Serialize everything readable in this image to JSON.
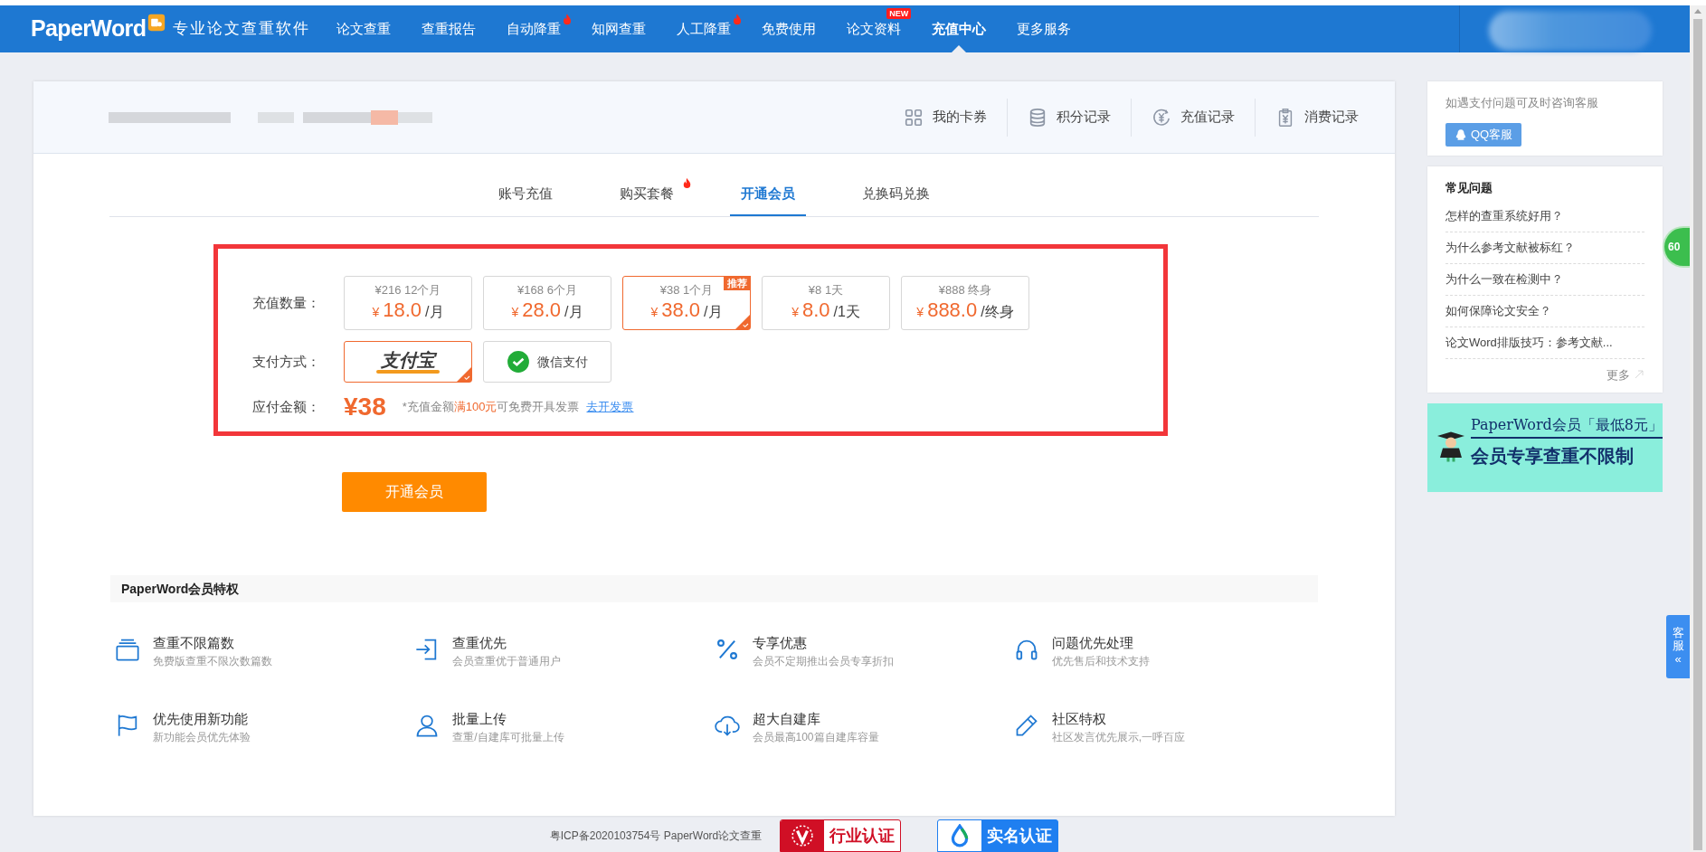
{
  "nav": {
    "logo": "PaperWord",
    "slogan": "专业论文查重软件",
    "items": [
      {
        "label": "论文查重",
        "hot": false,
        "selected": false
      },
      {
        "label": "查重报告",
        "hot": false,
        "selected": false
      },
      {
        "label": "自动降重",
        "hot": true,
        "selected": false
      },
      {
        "label": "知网查重",
        "hot": false,
        "selected": false
      },
      {
        "label": "人工降重",
        "hot": true,
        "selected": false
      },
      {
        "label": "免费使用",
        "hot": false,
        "selected": false
      },
      {
        "label": "论文资料",
        "hot": false,
        "new_badge": "NEW",
        "selected": false
      },
      {
        "label": "充值中心",
        "hot": false,
        "selected": true
      },
      {
        "label": "更多服务",
        "hot": false,
        "selected": false
      }
    ]
  },
  "account_links": [
    {
      "label": "我的卡券"
    },
    {
      "label": "积分记录"
    },
    {
      "label": "充值记录"
    },
    {
      "label": "消费记录"
    }
  ],
  "tabs": [
    {
      "label": "账号充值",
      "selected": false,
      "hot": false
    },
    {
      "label": "购买套餐",
      "selected": false,
      "hot": true
    },
    {
      "label": "开通会员",
      "selected": true,
      "hot": false
    },
    {
      "label": "兑换码兑换",
      "selected": false,
      "hot": false
    }
  ],
  "plans": {
    "label": "充值数量：",
    "options": [
      {
        "original": "¥216 12个月",
        "currency": "¥",
        "price": "18.0",
        "unit": "/月",
        "selected": false
      },
      {
        "original": "¥168 6个月",
        "currency": "¥",
        "price": "28.0",
        "unit": "/月",
        "selected": false
      },
      {
        "original": "¥38 1个月",
        "currency": "¥",
        "price": "38.0",
        "unit": "/月",
        "selected": true,
        "badge": "推荐"
      },
      {
        "original": "¥8 1天",
        "currency": "¥",
        "price": "8.0",
        "unit": "/1天",
        "selected": false
      },
      {
        "original": "¥888 终身",
        "currency": "¥",
        "price": "888.0",
        "unit": "/终身",
        "selected": false
      }
    ]
  },
  "payment": {
    "label": "支付方式：",
    "methods": [
      {
        "kind": "alipay",
        "label": "支付宝",
        "selected": true
      },
      {
        "kind": "wechat",
        "label": "微信支付",
        "selected": false
      }
    ]
  },
  "amount": {
    "label": "应付金额：",
    "value": "¥38",
    "note": "*充值金额**满100元**可免费开具发票",
    "link": "去开发票"
  },
  "submit": "开通会员",
  "benefits": {
    "title": "PaperWord会员特权",
    "items": [
      {
        "title": "查重不限篇数",
        "desc": "免费版查重不限次数篇数"
      },
      {
        "title": "查重优先",
        "desc": "会员查重优于普通用户"
      },
      {
        "title": "专享优惠",
        "desc": "会员不定期推出会员专享折扣"
      },
      {
        "title": "问题优先处理",
        "desc": "优先售后和技术支持"
      },
      {
        "title": "优先使用新功能",
        "desc": "新功能会员优先体验"
      },
      {
        "title": "批量上传",
        "desc": "查重/自建库可批量上传"
      },
      {
        "title": "超大自建库",
        "desc": "会员最高100篇自建库容量"
      },
      {
        "title": "社区特权",
        "desc": "社区发言优先展示,一呼百应"
      }
    ]
  },
  "sidebar": {
    "support_text": "如遇支付问题可及时咨询客服",
    "qq_button": "QQ客服",
    "faq_title": "常见问题",
    "faq": [
      "怎样的查重系统好用？",
      "为什么参考文献被标红？",
      "为什么一致在检测中？",
      "如何保障论文安全？",
      "论文Word排版技巧：参考文献..."
    ],
    "more": "更多",
    "banner_title": "PaperWord会员「最低8元」",
    "banner_subtitle": "会员专享查重不限制"
  },
  "float_tab": {
    "label": "客服",
    "arrow": "«"
  },
  "float_badge": "60",
  "footer": {
    "icp": "粤ICP备2020103754号 PaperWord论文查重",
    "badges": [
      "行业认证",
      "实名认证"
    ]
  }
}
